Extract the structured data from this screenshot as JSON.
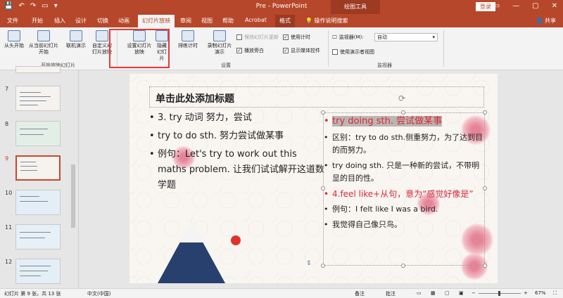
{
  "titlebar": {
    "qat": [
      "💾",
      "↶",
      "↷",
      "▭",
      "▾"
    ],
    "title": "Pre  -  PowerPoint",
    "tools_label": "绘图工具",
    "login": "登录",
    "window_controls": [
      "▭",
      "—",
      "▢",
      "✕"
    ]
  },
  "tabs": {
    "items": [
      "文件",
      "开始",
      "插入",
      "设计",
      "切换",
      "动画",
      "幻灯片放映",
      "审阅",
      "视图",
      "帮助",
      "Acrobat",
      "格式"
    ],
    "active": "幻灯片放映",
    "tell_me": "操作说明搜索",
    "share": "共享"
  },
  "ribbon": {
    "start_group": {
      "from_beginning": "从头开始",
      "from_current": "从当前幻灯片开始",
      "online": "联机演示",
      "custom": "自定义幻灯片放映",
      "label": "开始放映幻灯片"
    },
    "setup_group": {
      "setup": "设置幻灯片放映",
      "hide": "隐藏幻灯片",
      "rehearse": "排练计时",
      "record": "录制幻灯片演示",
      "play_narration": "播放旁白",
      "keep_updated": "保持幻灯片更新",
      "use_timings": "使用计时",
      "show_media": "显示媒体控件",
      "label": "设置"
    },
    "monitor_group": {
      "monitor_label": "监视器(M):",
      "monitor_value": "自动",
      "presenter_view": "使用演示者视图",
      "label": "监视器"
    }
  },
  "thumbnails": [
    {
      "num": "7",
      "selected": false
    },
    {
      "num": "8",
      "selected": false
    },
    {
      "num": "9",
      "selected": true
    },
    {
      "num": "10",
      "selected": false
    },
    {
      "num": "11",
      "selected": false
    },
    {
      "num": "12",
      "selected": false
    }
  ],
  "slide": {
    "title": "单击此处添加标题",
    "left_bullets": [
      "3. try 动词  努力，尝试",
      "try to do sth. 努力尝试做某事",
      " 例句：Let's try to work out this maths problem. 让我们试试解开这道数学题"
    ],
    "right_bullets": [
      "try doing sth. 尝试做某事",
      "区别：try to do sth.侧重努力，为了达到目的而努力。",
      "try doing sth. 只是一种新的尝试，不带明显的目的性。",
      "4.feel like+从句，意为“感觉好像是”",
      "例句：I felt like I was a bird.",
      "我觉得自己像只鸟。"
    ]
  },
  "status": {
    "slide_info": "幻灯片 第 9 张，共 13 张",
    "language": "中文(中国)",
    "notes": "备注",
    "comments": "批注",
    "zoom": "67%"
  },
  "colors": {
    "brand": "#b7472a",
    "highlight_red": "#d6293a",
    "frame_red": "#e53935"
  }
}
